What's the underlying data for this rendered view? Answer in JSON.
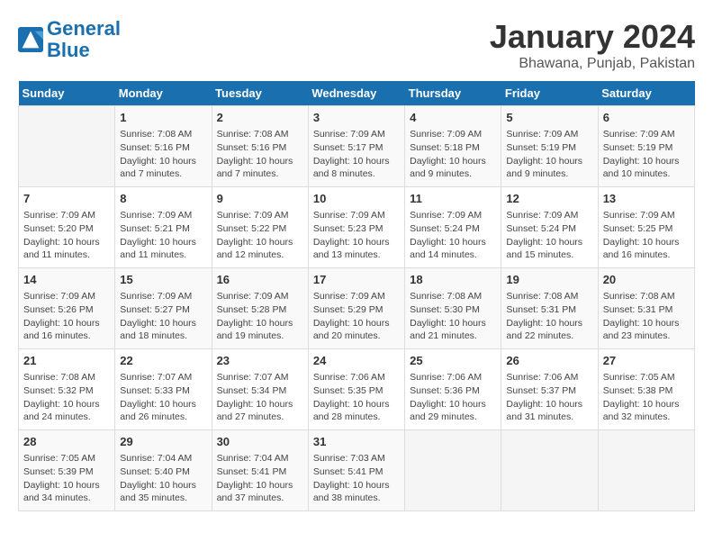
{
  "header": {
    "logo_line1": "General",
    "logo_line2": "Blue",
    "month_year": "January 2024",
    "location": "Bhawana, Punjab, Pakistan"
  },
  "days_of_week": [
    "Sunday",
    "Monday",
    "Tuesday",
    "Wednesday",
    "Thursday",
    "Friday",
    "Saturday"
  ],
  "weeks": [
    [
      {
        "num": "",
        "info": ""
      },
      {
        "num": "1",
        "info": "Sunrise: 7:08 AM\nSunset: 5:16 PM\nDaylight: 10 hours\nand 7 minutes."
      },
      {
        "num": "2",
        "info": "Sunrise: 7:08 AM\nSunset: 5:16 PM\nDaylight: 10 hours\nand 7 minutes."
      },
      {
        "num": "3",
        "info": "Sunrise: 7:09 AM\nSunset: 5:17 PM\nDaylight: 10 hours\nand 8 minutes."
      },
      {
        "num": "4",
        "info": "Sunrise: 7:09 AM\nSunset: 5:18 PM\nDaylight: 10 hours\nand 9 minutes."
      },
      {
        "num": "5",
        "info": "Sunrise: 7:09 AM\nSunset: 5:19 PM\nDaylight: 10 hours\nand 9 minutes."
      },
      {
        "num": "6",
        "info": "Sunrise: 7:09 AM\nSunset: 5:19 PM\nDaylight: 10 hours\nand 10 minutes."
      }
    ],
    [
      {
        "num": "7",
        "info": "Sunrise: 7:09 AM\nSunset: 5:20 PM\nDaylight: 10 hours\nand 11 minutes."
      },
      {
        "num": "8",
        "info": "Sunrise: 7:09 AM\nSunset: 5:21 PM\nDaylight: 10 hours\nand 11 minutes."
      },
      {
        "num": "9",
        "info": "Sunrise: 7:09 AM\nSunset: 5:22 PM\nDaylight: 10 hours\nand 12 minutes."
      },
      {
        "num": "10",
        "info": "Sunrise: 7:09 AM\nSunset: 5:23 PM\nDaylight: 10 hours\nand 13 minutes."
      },
      {
        "num": "11",
        "info": "Sunrise: 7:09 AM\nSunset: 5:24 PM\nDaylight: 10 hours\nand 14 minutes."
      },
      {
        "num": "12",
        "info": "Sunrise: 7:09 AM\nSunset: 5:24 PM\nDaylight: 10 hours\nand 15 minutes."
      },
      {
        "num": "13",
        "info": "Sunrise: 7:09 AM\nSunset: 5:25 PM\nDaylight: 10 hours\nand 16 minutes."
      }
    ],
    [
      {
        "num": "14",
        "info": "Sunrise: 7:09 AM\nSunset: 5:26 PM\nDaylight: 10 hours\nand 16 minutes."
      },
      {
        "num": "15",
        "info": "Sunrise: 7:09 AM\nSunset: 5:27 PM\nDaylight: 10 hours\nand 18 minutes."
      },
      {
        "num": "16",
        "info": "Sunrise: 7:09 AM\nSunset: 5:28 PM\nDaylight: 10 hours\nand 19 minutes."
      },
      {
        "num": "17",
        "info": "Sunrise: 7:09 AM\nSunset: 5:29 PM\nDaylight: 10 hours\nand 20 minutes."
      },
      {
        "num": "18",
        "info": "Sunrise: 7:08 AM\nSunset: 5:30 PM\nDaylight: 10 hours\nand 21 minutes."
      },
      {
        "num": "19",
        "info": "Sunrise: 7:08 AM\nSunset: 5:31 PM\nDaylight: 10 hours\nand 22 minutes."
      },
      {
        "num": "20",
        "info": "Sunrise: 7:08 AM\nSunset: 5:31 PM\nDaylight: 10 hours\nand 23 minutes."
      }
    ],
    [
      {
        "num": "21",
        "info": "Sunrise: 7:08 AM\nSunset: 5:32 PM\nDaylight: 10 hours\nand 24 minutes."
      },
      {
        "num": "22",
        "info": "Sunrise: 7:07 AM\nSunset: 5:33 PM\nDaylight: 10 hours\nand 26 minutes."
      },
      {
        "num": "23",
        "info": "Sunrise: 7:07 AM\nSunset: 5:34 PM\nDaylight: 10 hours\nand 27 minutes."
      },
      {
        "num": "24",
        "info": "Sunrise: 7:06 AM\nSunset: 5:35 PM\nDaylight: 10 hours\nand 28 minutes."
      },
      {
        "num": "25",
        "info": "Sunrise: 7:06 AM\nSunset: 5:36 PM\nDaylight: 10 hours\nand 29 minutes."
      },
      {
        "num": "26",
        "info": "Sunrise: 7:06 AM\nSunset: 5:37 PM\nDaylight: 10 hours\nand 31 minutes."
      },
      {
        "num": "27",
        "info": "Sunrise: 7:05 AM\nSunset: 5:38 PM\nDaylight: 10 hours\nand 32 minutes."
      }
    ],
    [
      {
        "num": "28",
        "info": "Sunrise: 7:05 AM\nSunset: 5:39 PM\nDaylight: 10 hours\nand 34 minutes."
      },
      {
        "num": "29",
        "info": "Sunrise: 7:04 AM\nSunset: 5:40 PM\nDaylight: 10 hours\nand 35 minutes."
      },
      {
        "num": "30",
        "info": "Sunrise: 7:04 AM\nSunset: 5:41 PM\nDaylight: 10 hours\nand 37 minutes."
      },
      {
        "num": "31",
        "info": "Sunrise: 7:03 AM\nSunset: 5:41 PM\nDaylight: 10 hours\nand 38 minutes."
      },
      {
        "num": "",
        "info": ""
      },
      {
        "num": "",
        "info": ""
      },
      {
        "num": "",
        "info": ""
      }
    ]
  ]
}
